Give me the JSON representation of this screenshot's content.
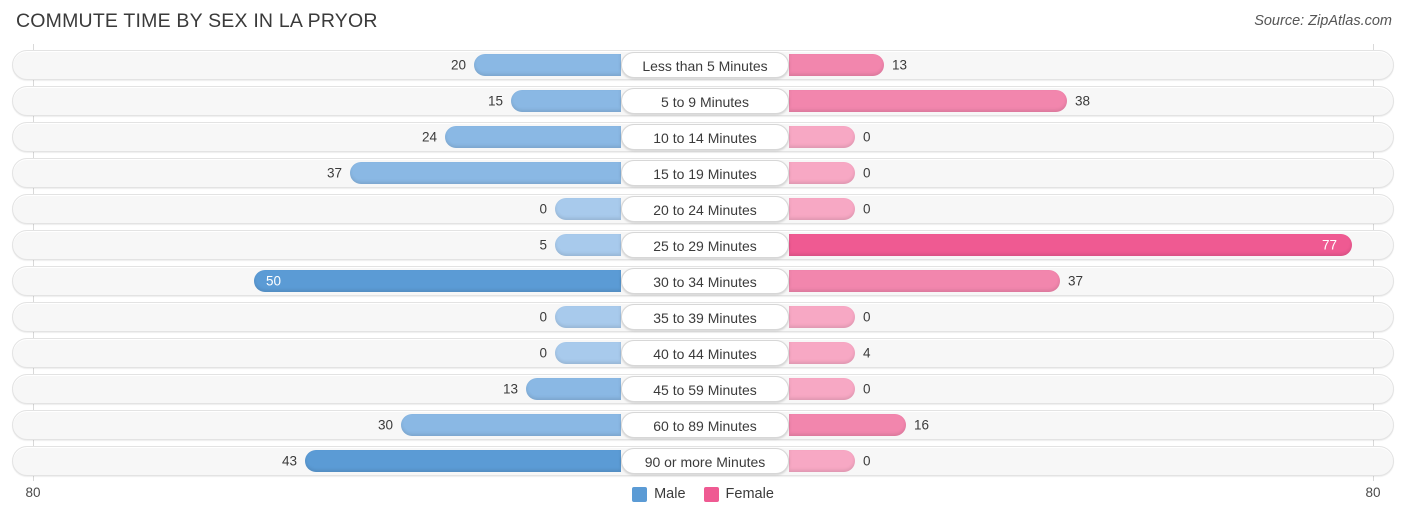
{
  "header": {
    "title": "COMMUTE TIME BY SEX IN LA PRYOR",
    "source": "Source: ZipAtlas.com"
  },
  "legend": {
    "male_label": "Male",
    "female_label": "Female",
    "male_color": "#5b9bd5",
    "female_color": "#ef5a92"
  },
  "axis": {
    "left_label": "80",
    "right_label": "80",
    "max": 80
  },
  "colors": {
    "male_light": "#a8caec",
    "male_mid": "#8ab8e4",
    "male_dark": "#5b9bd5",
    "female_light": "#f7a8c4",
    "female_mid": "#f286ad",
    "female_dark": "#ef5a92",
    "row_bg": "#f7f7f7",
    "row_border": "#e3e3e3",
    "gridline": "#d9d9d9"
  },
  "chart_data": {
    "type": "bar",
    "orientation": "horizontal",
    "layout": "diverging-bidirectional",
    "title": "COMMUTE TIME BY SEX IN LA PRYOR",
    "xlabel": "",
    "ylabel": "",
    "xlim": [
      80,
      80
    ],
    "grid": true,
    "legend_position": "bottom-center",
    "categories": [
      "Less than 5 Minutes",
      "5 to 9 Minutes",
      "10 to 14 Minutes",
      "15 to 19 Minutes",
      "20 to 24 Minutes",
      "25 to 29 Minutes",
      "30 to 34 Minutes",
      "35 to 39 Minutes",
      "40 to 44 Minutes",
      "45 to 59 Minutes",
      "60 to 89 Minutes",
      "90 or more Minutes"
    ],
    "series": [
      {
        "name": "Male",
        "direction": "left",
        "values": [
          20,
          15,
          24,
          37,
          0,
          5,
          50,
          0,
          0,
          13,
          30,
          43
        ]
      },
      {
        "name": "Female",
        "direction": "right",
        "values": [
          13,
          38,
          0,
          0,
          0,
          77,
          37,
          0,
          4,
          0,
          16,
          0
        ]
      }
    ]
  },
  "rows": [
    {
      "category": "Less than 5 Minutes",
      "male": "20",
      "female": "13"
    },
    {
      "category": "5 to 9 Minutes",
      "male": "15",
      "female": "38"
    },
    {
      "category": "10 to 14 Minutes",
      "male": "24",
      "female": "0"
    },
    {
      "category": "15 to 19 Minutes",
      "male": "37",
      "female": "0"
    },
    {
      "category": "20 to 24 Minutes",
      "male": "0",
      "female": "0"
    },
    {
      "category": "25 to 29 Minutes",
      "male": "5",
      "female": "77"
    },
    {
      "category": "30 to 34 Minutes",
      "male": "50",
      "female": "37"
    },
    {
      "category": "35 to 39 Minutes",
      "male": "0",
      "female": "0"
    },
    {
      "category": "40 to 44 Minutes",
      "male": "0",
      "female": "4"
    },
    {
      "category": "45 to 59 Minutes",
      "male": "13",
      "female": "0"
    },
    {
      "category": "60 to 89 Minutes",
      "male": "30",
      "female": "16"
    },
    {
      "category": "90 or more Minutes",
      "male": "43",
      "female": "0"
    }
  ]
}
